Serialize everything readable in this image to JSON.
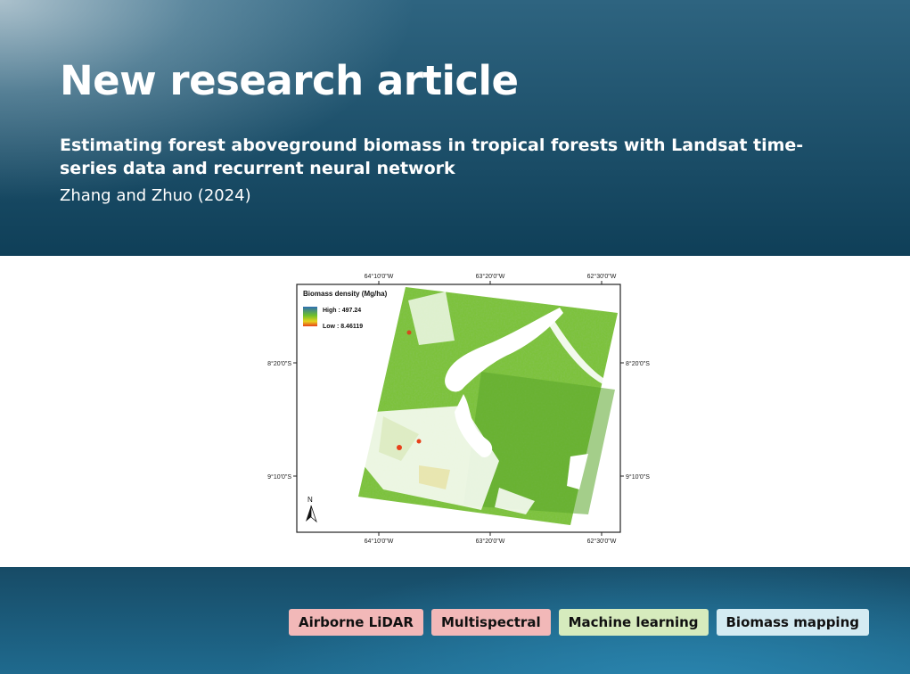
{
  "header": {
    "headline": "New research article",
    "article_title": "Estimating forest aboveground biomass in tropical forests with Landsat time-series data and recurrent neural network",
    "authors": "Zhang and Zhuo (2024)"
  },
  "map": {
    "legend_title": "Biomass density (Mg/ha)",
    "legend_high": "High : 497.24",
    "legend_low": "Low : 8.46119",
    "north_label": "N",
    "lon_labels": [
      "64°10'0\"W",
      "63°20'0\"W",
      "62°30'0\"W"
    ],
    "lat_labels": [
      "8°20'0\"S",
      "9°10'0\"S"
    ],
    "colors": {
      "high": "#2f6fb3",
      "mid": "#6fbf2a",
      "low": "#e8401a",
      "water": "#ffffff"
    }
  },
  "tags": [
    {
      "label": "Airborne LiDAR",
      "color": "#f2b8b8"
    },
    {
      "label": "Multispectral",
      "color": "#f2b8b8"
    },
    {
      "label": "Machine learning",
      "color": "#d6ebbd"
    },
    {
      "label": "Biomass mapping",
      "color": "#d4ebf2"
    }
  ]
}
